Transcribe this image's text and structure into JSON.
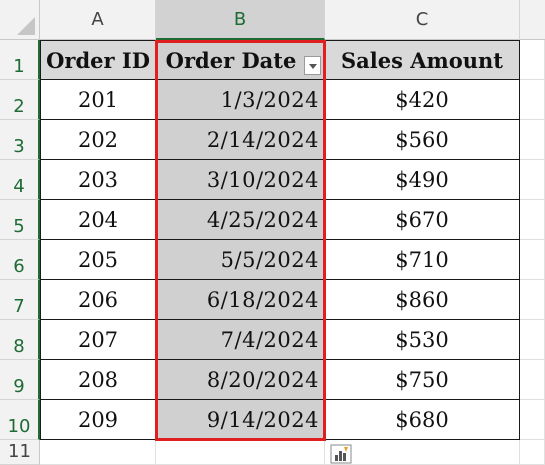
{
  "columns": [
    "A",
    "B",
    "C"
  ],
  "row_numbers": [
    "1",
    "2",
    "3",
    "4",
    "5",
    "6",
    "7",
    "8",
    "9",
    "10",
    "11"
  ],
  "table": {
    "headers": [
      "Order ID",
      "Order Date",
      "Sales Amount"
    ],
    "rows": [
      [
        "201",
        "1/3/2024",
        "$420"
      ],
      [
        "202",
        "2/14/2024",
        "$560"
      ],
      [
        "203",
        "3/10/2024",
        "$490"
      ],
      [
        "204",
        "4/25/2024",
        "$670"
      ],
      [
        "205",
        "5/5/2024",
        "$710"
      ],
      [
        "206",
        "6/18/2024",
        "$860"
      ],
      [
        "207",
        "7/4/2024",
        "$530"
      ],
      [
        "208",
        "8/20/2024",
        "$750"
      ],
      [
        "209",
        "9/14/2024",
        "$680"
      ]
    ]
  },
  "colors": {
    "selection_border": "#e02020",
    "selected_header_accent": "#1e6b34",
    "selected_fill": "#d0d0d0",
    "header_fill": "#d9d9d9"
  },
  "icons": {
    "filter": "filter-dropdown-icon",
    "quick_analysis": "quick-analysis-icon"
  }
}
